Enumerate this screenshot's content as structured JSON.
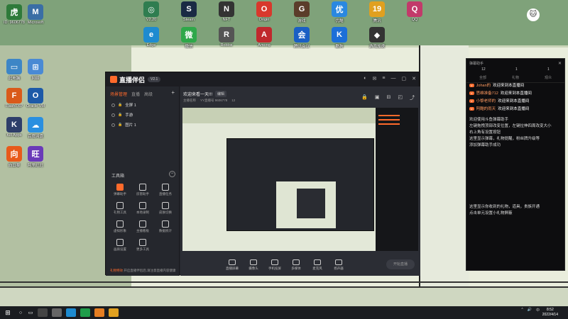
{
  "desktop": {
    "icons_left": [
      {
        "label": "ID: 9606778",
        "color": "#2e7a3a",
        "glyph": "虎"
      },
      {
        "label": "Microsoft",
        "color": "#3a6ea5",
        "glyph": "M"
      },
      {
        "label": "此电脑",
        "color": "#3d86c6",
        "glyph": "▭"
      },
      {
        "label": "网络",
        "color": "#4a8ad4",
        "glyph": "⊞"
      },
      {
        "label": "FlashFXP",
        "color": "#d95a1a",
        "glyph": "F"
      },
      {
        "label": "Oracle VM",
        "color": "#1d5aa8",
        "glyph": "O"
      },
      {
        "label": "Kill Apps",
        "color": "#2e3e6a",
        "glyph": "K"
      },
      {
        "label": "百度网盘",
        "color": "#2a8fe0",
        "glyph": "☁"
      },
      {
        "label": "向日葵",
        "color": "#e85a1a",
        "glyph": "向"
      },
      {
        "label": "阿里旺旺",
        "color": "#6a3ab8",
        "glyph": "旺"
      }
    ],
    "icons_top": [
      {
        "label": "V2.20",
        "color": "#2f7d50",
        "glyph": "◎"
      },
      {
        "label": "Steam",
        "color": "#1a2a44",
        "glyph": "S"
      },
      {
        "label": "NFT",
        "color": "#333",
        "glyph": "N"
      },
      {
        "label": "Origin",
        "color": "#d8382c",
        "glyph": "O"
      },
      {
        "label": "游戏",
        "color": "#5b3d2a",
        "glyph": "G"
      },
      {
        "label": "优酷",
        "color": "#2a88e0",
        "glyph": "优"
      },
      {
        "label": "腾讯",
        "color": "#e0a020",
        "glyph": "19"
      },
      {
        "label": "QQ",
        "color": "#c23a6a",
        "glyph": "Q"
      },
      {
        "label": "Edge",
        "color": "#1e8bd0",
        "glyph": "e"
      },
      {
        "label": "微信",
        "color": "#2fa84a",
        "glyph": "微"
      },
      {
        "label": "Roblox",
        "color": "#555",
        "glyph": "R"
      },
      {
        "label": "Among",
        "color": "#c0282d",
        "glyph": "A"
      },
      {
        "label": "腾讯会议",
        "color": "#1a5fc4",
        "glyph": "会"
      },
      {
        "label": "酷狗",
        "color": "#1c6fd8",
        "glyph": "K"
      },
      {
        "label": "游戏加速",
        "color": "#333",
        "glyph": "◆"
      }
    ],
    "right_avatar": "cat-face"
  },
  "app": {
    "logo": "直播伴侣",
    "version": "V2.1",
    "left_tabs": [
      "场景管理",
      "直播",
      "高级"
    ],
    "scenes": [
      {
        "name": "全屏 1"
      },
      {
        "name": "手游"
      },
      {
        "name": "图片 1"
      }
    ],
    "tools_title": "工具箱",
    "tools": [
      {
        "label": "弹幕助手",
        "highlight": true
      },
      {
        "label": "房管助手",
        "highlight": false
      },
      {
        "label": "直播任务",
        "highlight": false
      },
      {
        "label": "礼物工具",
        "highlight": false
      },
      {
        "label": "本地录制",
        "highlight": false
      },
      {
        "label": "皮肤切换",
        "highlight": false
      },
      {
        "label": "虚拟形象",
        "highlight": false
      },
      {
        "label": "主播看板",
        "highlight": false
      },
      {
        "label": "数据统计",
        "highlight": false
      },
      {
        "label": "画质设置",
        "highlight": false
      },
      {
        "label": "更多工具",
        "highlight": false
      }
    ],
    "notice_prefix": "礼物特效",
    "notice_text": "开启直播伴侣后,请注意直播内容健康",
    "stream_title": "欢迎来看一天!!!",
    "edit_label": "编辑",
    "sub_info": [
      "主播名称",
      "YY直播号 9606778",
      "12"
    ],
    "bottom_bar": [
      {
        "label": "直播屏幕"
      },
      {
        "label": "摄像头"
      },
      {
        "label": "手机投屏"
      },
      {
        "label": "多媒体"
      },
      {
        "label": "麦克风"
      },
      {
        "label": "扬声器"
      }
    ],
    "start_label": "开始直播"
  },
  "helper": {
    "title": "弹幕助手",
    "stats": [
      "12",
      "1",
      "1"
    ],
    "tabs": [
      "全部",
      "礼物",
      "观众"
    ],
    "welcomes": [
      {
        "user": "Johan的",
        "text": "欢迎来到本直播间"
      },
      {
        "user": "思维准备712",
        "text": "欢迎来到本直播间"
      },
      {
        "user": "小黎老师的",
        "text": "欢迎来到本直播间"
      },
      {
        "user": "阿酷的雨天",
        "text": "欢迎来到本直播间"
      }
    ],
    "messages": [
      "欢迎使用斗鱼弹幕助手",
      "左键拖拽顶部改变位置，左键拉伸四周改变大小",
      "右上角有设置按钮",
      "这里显示弹幕，礼物提醒，粉丝牌升级等",
      "添加弹幕助手成功"
    ],
    "messages2": [
      "这里显示你收到的礼物，道具，贵族开通",
      "点击单元设置小礼物屏蔽"
    ]
  },
  "taskbar": {
    "start_glyph": "⊞",
    "icons": [
      "#444",
      "#666",
      "#1e8bd0",
      "#1f9d4a",
      "#e67e22",
      "#e0a020"
    ],
    "tray": [
      "^",
      "🔊",
      "中"
    ],
    "time": "8:52",
    "date": "2022/4/14"
  }
}
